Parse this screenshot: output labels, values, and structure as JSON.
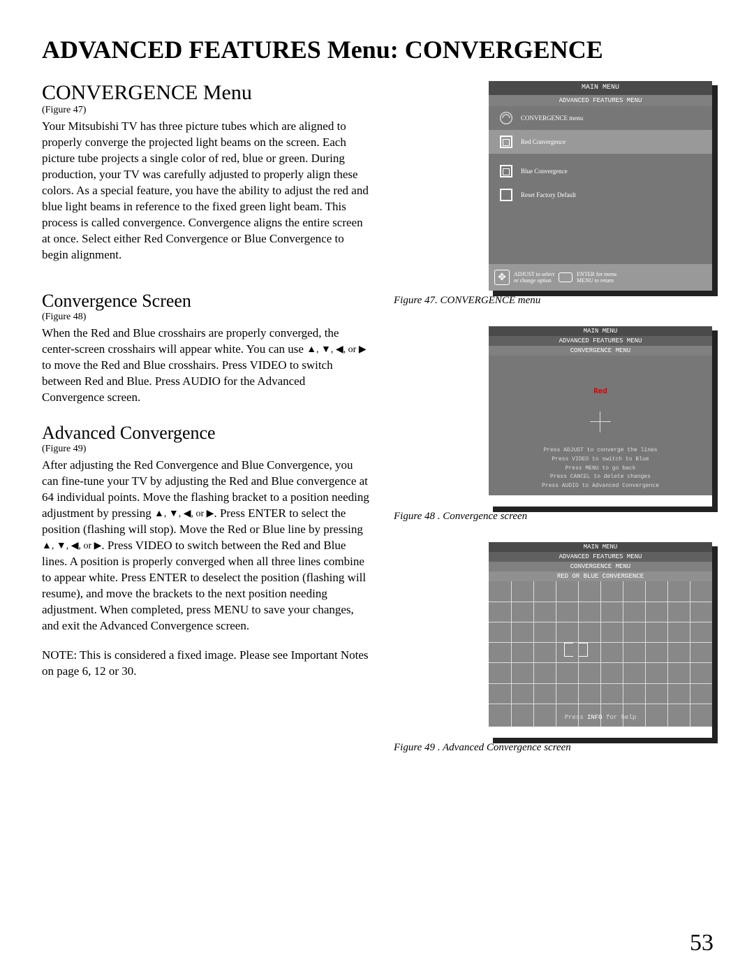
{
  "page_title": "ADVANCED FEATURES Menu: CONVERGENCE",
  "page_number": "53",
  "sections": {
    "main": {
      "heading": "CONVERGENCE Menu",
      "figref": "(Figure 47)",
      "para": "Your Mitsubishi TV has three picture tubes which are aligned to properly converge the projected light beams on the screen.  Each picture tube projects a single color of red, blue or green.  During production, your TV was carefully adjusted to properly align these colors.  As a special feature, you have the ability to adjust the red and blue light beams in reference to the fixed green light beam. This process is called convergence.  Convergence aligns the entire screen at once.  Select either Red Convergence or Blue Convergence to begin alignment."
    },
    "screen": {
      "heading": "Convergence Screen",
      "figref": "(Figure 48)",
      "para_a": "When the Red and Blue crosshairs are properly converged, the center-screen crosshairs will appear white.  You can use ",
      "para_b": " to move the Red and Blue crosshairs.  Press VIDEO to switch between Red and Blue.  Press AUDIO for the Advanced Convergence screen."
    },
    "advanced": {
      "heading": "Advanced Convergence",
      "figref": "(Figure 49)",
      "para1_a": "After adjusting the Red Convergence and Blue Convergence, you can fine-tune your TV by adjusting the Red and Blue convergence at 64 individual points. Move the flashing bracket to a position needing adjustment by pressing ",
      "para1_b": ".  Press ENTER to select the position (flashing will stop).  Move the Red or Blue line by pressing ",
      "para1_c": ".  Press VIDEO to switch between the Red and Blue lines. A position is properly converged when all three lines combine to appear white.  Press ENTER to deselect the position (flashing will resume), and move the brackets to the next position needing adjustment. When completed, press MENU to save your changes, and exit the Advanced Convergence screen.",
      "note": "NOTE: This is considered a fixed image.  Please see Important Notes on page 6, 12 or 30."
    }
  },
  "fig47": {
    "main_menu": "MAIN MENU",
    "af_menu": "ADVANCED FEATURES MENU",
    "items": [
      "CONVERGENCE menu",
      "Red Convergence",
      "Blue Convergence",
      "Reset Factory Default"
    ],
    "foot_left": "ADJUST to select",
    "foot_right": "ENTER for menu",
    "foot_left2": "or change option",
    "foot_right2": "MENU to return",
    "caption": "Figure 47.  CONVERGENCE menu"
  },
  "fig48": {
    "main_menu": "MAIN MENU",
    "af_menu": "ADVANCED FEATURES MENU",
    "conv_menu": "CONVERGENCE MENU",
    "red": "Red",
    "tips": [
      "Press ADJUST to converge the lines",
      "Press VIDEO to switch to Blue",
      "Press MENU to go back",
      "Press CANCEL to delete changes",
      "Press AUDIO to Advanced Convergence"
    ],
    "caption": "Figure 48 .  Convergence screen"
  },
  "fig49": {
    "main_menu": "MAIN MENU",
    "af_menu": "ADVANCED FEATURES MENU",
    "conv_menu": "CONVERGENCE MENU",
    "rb": "RED OR BLUE CONVERGENCE",
    "tip_a": "Press ",
    "tip_hl": "INFO",
    "tip_b": " for help",
    "caption": "Figure  49 .  Advanced Convergence screen"
  },
  "arrows": "▲, ▼, ◀, or ▶"
}
